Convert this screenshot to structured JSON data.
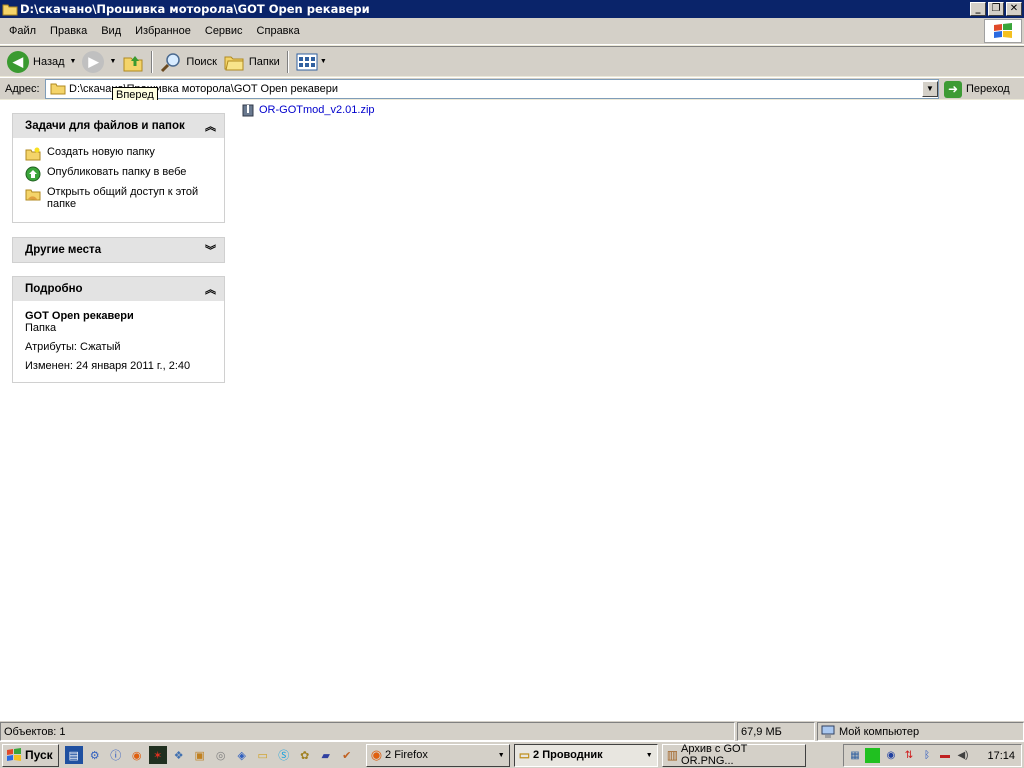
{
  "window": {
    "title": "D:\\скачано\\Прошивка моторола\\GOT Open рекавери"
  },
  "menu": {
    "items": [
      "Файл",
      "Правка",
      "Вид",
      "Избранное",
      "Сервис",
      "Справка"
    ]
  },
  "toolbar": {
    "back_label": "Назад",
    "search_label": "Поиск",
    "folders_label": "Папки"
  },
  "address": {
    "label": "Адрес:",
    "value": "D:\\скачано\\Прошивка моторола\\GOT Open рекавери",
    "go_label": "Переход",
    "tooltip": "Вперед"
  },
  "tasks_panel": {
    "title": "Задачи для файлов и папок",
    "items": [
      {
        "label": "Создать новую папку",
        "icon": "new-folder-icon"
      },
      {
        "label": "Опубликовать папку в вебе",
        "icon": "web-publish-icon"
      },
      {
        "label": "Открыть общий доступ к этой папке",
        "icon": "share-folder-icon"
      }
    ]
  },
  "other_places": {
    "title": "Другие места"
  },
  "details": {
    "title": "Подробно",
    "name": "GOT Open рекавери",
    "type": "Папка",
    "attributes": "Атрибуты: Сжатый",
    "modified": "Изменен: 24 января 2011 г., 2:40"
  },
  "files": [
    {
      "name": "OR-GOTmod_v2.01.zip",
      "icon": "zip-file-icon"
    }
  ],
  "status": {
    "objects": "Объектов: 1",
    "size": "67,9 МБ",
    "location": "Мой компьютер"
  },
  "taskbar": {
    "start_label": "Пуск",
    "buttons": [
      {
        "label": "2 Firefox",
        "active": false
      },
      {
        "label": "2 Проводник",
        "active": true
      },
      {
        "label": "Архив с GOT OR.PNG...",
        "active": false
      }
    ],
    "clock": "17:14"
  },
  "colors": {
    "titlebar": "#0a246a",
    "link": "#0000cc",
    "panel_header": "#e3e3e3"
  }
}
